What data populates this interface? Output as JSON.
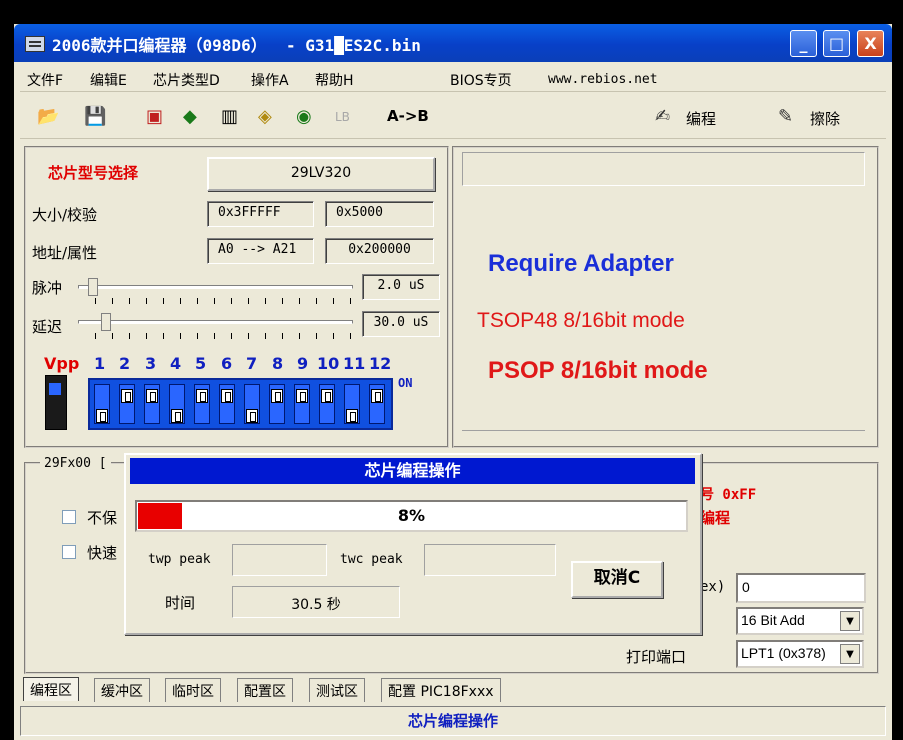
{
  "window": {
    "title": "2006款并口编程器（098D6）  - G31█ES2C.bin",
    "buttons": {
      "minimize": "_",
      "maximize": "□",
      "close": "X"
    }
  },
  "menu": {
    "items": [
      "文件F",
      "编辑E",
      "芯片类型D",
      "操作A",
      "帮助H"
    ],
    "bios": "BIOS专页",
    "url": "www.rebios.net"
  },
  "toolbar": {
    "lb": "LB",
    "ab": "A->B",
    "program": "编程",
    "erase": "擦除"
  },
  "chip": {
    "select_label": "芯片型号选择",
    "select_value": "29LV320",
    "size_label": "大小/校验",
    "size_value": "0x3FFFFF",
    "checksum_value": "0x5000",
    "addr_label": "地址/属性",
    "addr_value": "A0 --> A21",
    "attr_value": "0x200000",
    "pulse_label": "脉冲",
    "pulse_value": "2.0 uS",
    "delay_label": "延迟",
    "delay_value": "30.0 uS"
  },
  "vpp": {
    "label": "Vpp",
    "numbers": [
      "1",
      "2",
      "3",
      "4",
      "5",
      "6",
      "7",
      "8",
      "9",
      "10",
      "11",
      "12"
    ],
    "on_label": "ON"
  },
  "adapter": {
    "line1": "Require Adapter",
    "line2": "TSOP48 8/16bit mode",
    "line3": "PSOP 8/16bit mode",
    "colors": {
      "blue": "#1A2FD8",
      "red": "#E01818"
    }
  },
  "lower": {
    "group_title": "29Fx00 [",
    "check1": "不保",
    "check2": "快速",
    "right_text1": "号 0xFF",
    "right_text2": "编程",
    "hex_label": "ex)",
    "hex_value": "0",
    "mode_value": "16 Bit Add",
    "port_label": "打印端口",
    "port_value": "LPT1 (0x378)"
  },
  "dialog": {
    "title": "芯片编程操作",
    "progress_text": "8%",
    "progress": 0.08,
    "twp_label": "twp peak",
    "twc_label": "twc peak",
    "time_label": "时间",
    "time_value": "30.5 秒",
    "cancel": "取消C"
  },
  "tabs": [
    "编程区",
    "缓冲区",
    "临时区",
    "配置区",
    "测试区",
    "配置 PIC18Fxxx"
  ],
  "status": "芯片编程操作"
}
